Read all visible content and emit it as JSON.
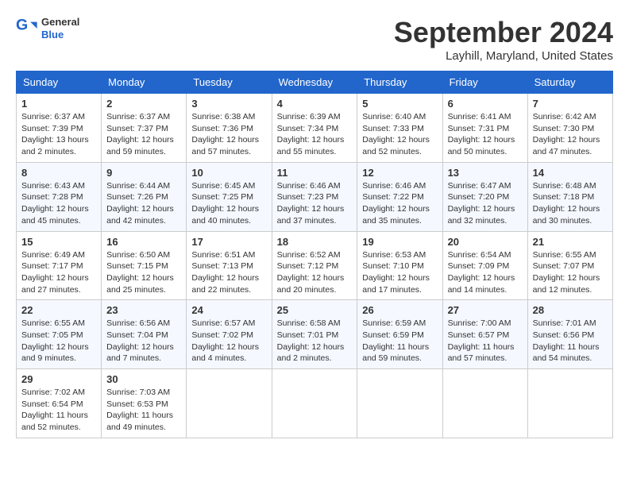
{
  "header": {
    "logo_general": "General",
    "logo_blue": "Blue",
    "month": "September 2024",
    "location": "Layhill, Maryland, United States"
  },
  "columns": [
    "Sunday",
    "Monday",
    "Tuesday",
    "Wednesday",
    "Thursday",
    "Friday",
    "Saturday"
  ],
  "weeks": [
    [
      {
        "day": "1",
        "sunrise": "Sunrise: 6:37 AM",
        "sunset": "Sunset: 7:39 PM",
        "daylight": "Daylight: 13 hours and 2 minutes."
      },
      {
        "day": "2",
        "sunrise": "Sunrise: 6:37 AM",
        "sunset": "Sunset: 7:37 PM",
        "daylight": "Daylight: 12 hours and 59 minutes."
      },
      {
        "day": "3",
        "sunrise": "Sunrise: 6:38 AM",
        "sunset": "Sunset: 7:36 PM",
        "daylight": "Daylight: 12 hours and 57 minutes."
      },
      {
        "day": "4",
        "sunrise": "Sunrise: 6:39 AM",
        "sunset": "Sunset: 7:34 PM",
        "daylight": "Daylight: 12 hours and 55 minutes."
      },
      {
        "day": "5",
        "sunrise": "Sunrise: 6:40 AM",
        "sunset": "Sunset: 7:33 PM",
        "daylight": "Daylight: 12 hours and 52 minutes."
      },
      {
        "day": "6",
        "sunrise": "Sunrise: 6:41 AM",
        "sunset": "Sunset: 7:31 PM",
        "daylight": "Daylight: 12 hours and 50 minutes."
      },
      {
        "day": "7",
        "sunrise": "Sunrise: 6:42 AM",
        "sunset": "Sunset: 7:30 PM",
        "daylight": "Daylight: 12 hours and 47 minutes."
      }
    ],
    [
      {
        "day": "8",
        "sunrise": "Sunrise: 6:43 AM",
        "sunset": "Sunset: 7:28 PM",
        "daylight": "Daylight: 12 hours and 45 minutes."
      },
      {
        "day": "9",
        "sunrise": "Sunrise: 6:44 AM",
        "sunset": "Sunset: 7:26 PM",
        "daylight": "Daylight: 12 hours and 42 minutes."
      },
      {
        "day": "10",
        "sunrise": "Sunrise: 6:45 AM",
        "sunset": "Sunset: 7:25 PM",
        "daylight": "Daylight: 12 hours and 40 minutes."
      },
      {
        "day": "11",
        "sunrise": "Sunrise: 6:46 AM",
        "sunset": "Sunset: 7:23 PM",
        "daylight": "Daylight: 12 hours and 37 minutes."
      },
      {
        "day": "12",
        "sunrise": "Sunrise: 6:46 AM",
        "sunset": "Sunset: 7:22 PM",
        "daylight": "Daylight: 12 hours and 35 minutes."
      },
      {
        "day": "13",
        "sunrise": "Sunrise: 6:47 AM",
        "sunset": "Sunset: 7:20 PM",
        "daylight": "Daylight: 12 hours and 32 minutes."
      },
      {
        "day": "14",
        "sunrise": "Sunrise: 6:48 AM",
        "sunset": "Sunset: 7:18 PM",
        "daylight": "Daylight: 12 hours and 30 minutes."
      }
    ],
    [
      {
        "day": "15",
        "sunrise": "Sunrise: 6:49 AM",
        "sunset": "Sunset: 7:17 PM",
        "daylight": "Daylight: 12 hours and 27 minutes."
      },
      {
        "day": "16",
        "sunrise": "Sunrise: 6:50 AM",
        "sunset": "Sunset: 7:15 PM",
        "daylight": "Daylight: 12 hours and 25 minutes."
      },
      {
        "day": "17",
        "sunrise": "Sunrise: 6:51 AM",
        "sunset": "Sunset: 7:13 PM",
        "daylight": "Daylight: 12 hours and 22 minutes."
      },
      {
        "day": "18",
        "sunrise": "Sunrise: 6:52 AM",
        "sunset": "Sunset: 7:12 PM",
        "daylight": "Daylight: 12 hours and 20 minutes."
      },
      {
        "day": "19",
        "sunrise": "Sunrise: 6:53 AM",
        "sunset": "Sunset: 7:10 PM",
        "daylight": "Daylight: 12 hours and 17 minutes."
      },
      {
        "day": "20",
        "sunrise": "Sunrise: 6:54 AM",
        "sunset": "Sunset: 7:09 PM",
        "daylight": "Daylight: 12 hours and 14 minutes."
      },
      {
        "day": "21",
        "sunrise": "Sunrise: 6:55 AM",
        "sunset": "Sunset: 7:07 PM",
        "daylight": "Daylight: 12 hours and 12 minutes."
      }
    ],
    [
      {
        "day": "22",
        "sunrise": "Sunrise: 6:55 AM",
        "sunset": "Sunset: 7:05 PM",
        "daylight": "Daylight: 12 hours and 9 minutes."
      },
      {
        "day": "23",
        "sunrise": "Sunrise: 6:56 AM",
        "sunset": "Sunset: 7:04 PM",
        "daylight": "Daylight: 12 hours and 7 minutes."
      },
      {
        "day": "24",
        "sunrise": "Sunrise: 6:57 AM",
        "sunset": "Sunset: 7:02 PM",
        "daylight": "Daylight: 12 hours and 4 minutes."
      },
      {
        "day": "25",
        "sunrise": "Sunrise: 6:58 AM",
        "sunset": "Sunset: 7:01 PM",
        "daylight": "Daylight: 12 hours and 2 minutes."
      },
      {
        "day": "26",
        "sunrise": "Sunrise: 6:59 AM",
        "sunset": "Sunset: 6:59 PM",
        "daylight": "Daylight: 11 hours and 59 minutes."
      },
      {
        "day": "27",
        "sunrise": "Sunrise: 7:00 AM",
        "sunset": "Sunset: 6:57 PM",
        "daylight": "Daylight: 11 hours and 57 minutes."
      },
      {
        "day": "28",
        "sunrise": "Sunrise: 7:01 AM",
        "sunset": "Sunset: 6:56 PM",
        "daylight": "Daylight: 11 hours and 54 minutes."
      }
    ],
    [
      {
        "day": "29",
        "sunrise": "Sunrise: 7:02 AM",
        "sunset": "Sunset: 6:54 PM",
        "daylight": "Daylight: 11 hours and 52 minutes."
      },
      {
        "day": "30",
        "sunrise": "Sunrise: 7:03 AM",
        "sunset": "Sunset: 6:53 PM",
        "daylight": "Daylight: 11 hours and 49 minutes."
      },
      null,
      null,
      null,
      null,
      null
    ]
  ]
}
